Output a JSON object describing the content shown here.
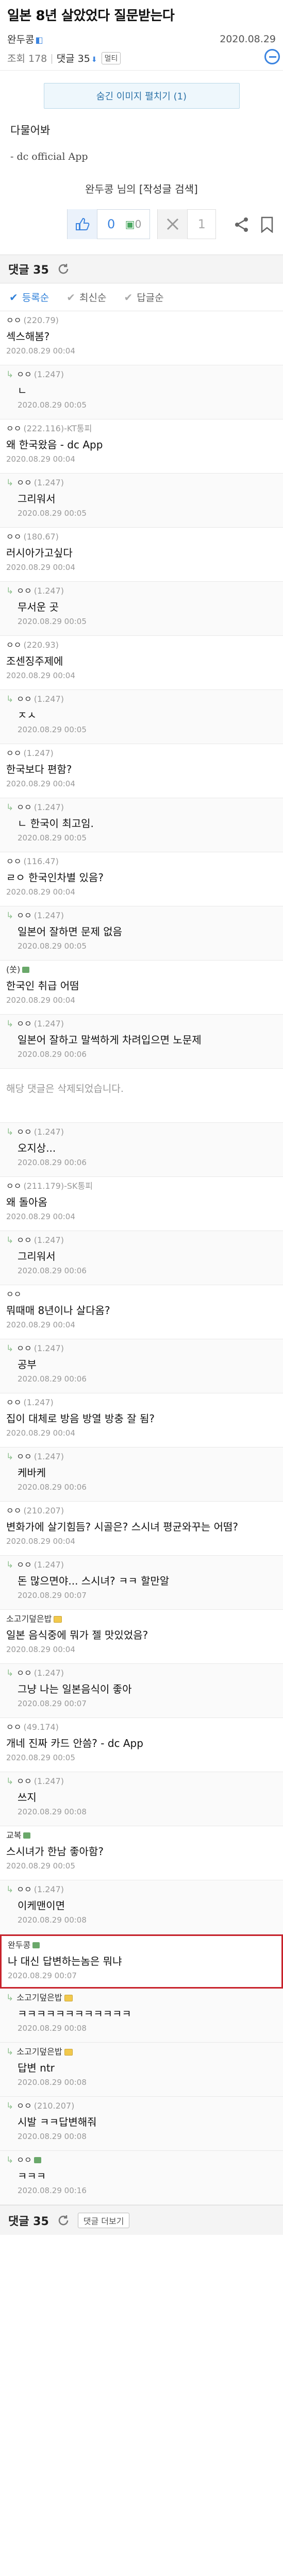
{
  "post": {
    "title": "일본 8년 살았었다 질문받는다",
    "author": "완두콩",
    "date": "2020.08.29",
    "views": "조회 178",
    "comment_count": "댓글 35",
    "chip": "멀티",
    "image_toggle": "숨긴 이미지 펼치기 (1)",
    "body_line": "다물어봐",
    "signature": "- dc official App",
    "search_name": "완두콩 님의",
    "search_link": "[작성글 검색]",
    "vote_up": "0",
    "fix_count": "0",
    "vote_down": "1"
  },
  "comments_header": {
    "label": "댓글 35"
  },
  "sort": {
    "options": [
      "등록순",
      "최신순",
      "답글순"
    ]
  },
  "comments": [
    {
      "reply": false,
      "nick": "ㅇㅇ",
      "ip": "(220.79)",
      "text": "섹스해봄?",
      "time": "2020.08.29 00:04"
    },
    {
      "reply": true,
      "nick": "ㅇㅇ",
      "ip": "(1.247)",
      "text": "ㄴ",
      "time": "2020.08.29 00:05"
    },
    {
      "reply": false,
      "nick": "ㅇㅇ",
      "ip": "(222.116)-KT통피",
      "text": "왜 한국왔음 - dc App",
      "time": "2020.08.29 00:04"
    },
    {
      "reply": true,
      "nick": "ㅇㅇ",
      "ip": "(1.247)",
      "text": "그리워서",
      "time": "2020.08.29 00:05"
    },
    {
      "reply": false,
      "nick": "ㅇㅇ",
      "ip": "(180.67)",
      "text": "러시아가고싶다",
      "time": "2020.08.29 00:04"
    },
    {
      "reply": true,
      "nick": "ㅇㅇ",
      "ip": "(1.247)",
      "text": "무서운 곳",
      "time": "2020.08.29 00:05"
    },
    {
      "reply": false,
      "nick": "ㅇㅇ",
      "ip": "(220.93)",
      "text": "조센징주제에",
      "time": "2020.08.29 00:04"
    },
    {
      "reply": true,
      "nick": "ㅇㅇ",
      "ip": "(1.247)",
      "text": "ㅈㅅ",
      "time": "2020.08.29 00:05"
    },
    {
      "reply": false,
      "nick": "ㅇㅇ",
      "ip": "(1.247)",
      "text": "한국보다 편함?",
      "time": "2020.08.29 00:04"
    },
    {
      "reply": true,
      "nick": "ㅇㅇ",
      "ip": "(1.247)",
      "text": "ㄴ 한국이 최고임.",
      "time": "2020.08.29 00:05"
    },
    {
      "reply": false,
      "nick": "ㅇㅇ",
      "ip": "(116.47)",
      "text": "ㄹㅇ 한국인차별 있음?",
      "time": "2020.08.29 00:04"
    },
    {
      "reply": true,
      "nick": "ㅇㅇ",
      "ip": "(1.247)",
      "text": "일본어 잘하면 문제 없음",
      "time": "2020.08.29 00:05"
    },
    {
      "reply": false,
      "nick": "(쏫)",
      "ip": "",
      "badge": "green",
      "text": "한국인 취급 어떰",
      "time": "2020.08.29 00:04"
    },
    {
      "reply": true,
      "nick": "ㅇㅇ",
      "ip": "(1.247)",
      "text": "일본어 잘하고 말썩하게 차려입으면 노문제",
      "time": "2020.08.29 00:06"
    },
    {
      "reply": false,
      "deleted": true,
      "text": "해당 댓글은 삭제되었습니다."
    },
    {
      "reply": true,
      "nick": "ㅇㅇ",
      "ip": "(1.247)",
      "text": "오지상...",
      "time": "2020.08.29 00:06"
    },
    {
      "reply": false,
      "nick": "ㅇㅇ",
      "ip": "(211.179)-SK통피",
      "text": "왜 돌아옴",
      "time": "2020.08.29 00:04"
    },
    {
      "reply": true,
      "nick": "ㅇㅇ",
      "ip": "(1.247)",
      "text": "그리워서",
      "time": "2020.08.29 00:06"
    },
    {
      "reply": false,
      "nick": "ㅇㅇ",
      "ip": "",
      "text": "뭐때매 8년이나 살다옴?",
      "time": "2020.08.29 00:04"
    },
    {
      "reply": true,
      "nick": "ㅇㅇ",
      "ip": "(1.247)",
      "text": "공부",
      "time": "2020.08.29 00:06"
    },
    {
      "reply": false,
      "nick": "ㅇㅇ",
      "ip": "(1.247)",
      "text": "집이 대체로 방음 방열 방충 잘 됨?",
      "time": "2020.08.29 00:04"
    },
    {
      "reply": true,
      "nick": "ㅇㅇ",
      "ip": "(1.247)",
      "text": "케바케",
      "time": "2020.08.29 00:06"
    },
    {
      "reply": false,
      "nick": "ㅇㅇ",
      "ip": "(210.207)",
      "text": "변화가에 살기힘듬? 시골은? 스시녀 평균와꾸는 어떰?",
      "time": "2020.08.29 00:04"
    },
    {
      "reply": true,
      "nick": "ㅇㅇ",
      "ip": "(1.247)",
      "text": "돈 많으면야... 스시녀? ㅋㅋ 할만알",
      "time": "2020.08.29 00:07"
    },
    {
      "reply": false,
      "nick": "소고기덮은밥",
      "ip": "",
      "badge": "yellow",
      "text": "일본 음식중에 뭐가 젤 맛있었음?",
      "time": "2020.08.29 00:04"
    },
    {
      "reply": true,
      "nick": "ㅇㅇ",
      "ip": "(1.247)",
      "text": "그냥 나는 일본음식이 좋아",
      "time": "2020.08.29 00:07"
    },
    {
      "reply": false,
      "nick": "ㅇㅇ",
      "ip": "(49.174)",
      "text": "개네 진짜 카드 안씀? - dc App",
      "time": "2020.08.29 00:05"
    },
    {
      "reply": true,
      "nick": "ㅇㅇ",
      "ip": "(1.247)",
      "text": "쓰지",
      "time": "2020.08.29 00:08"
    },
    {
      "reply": false,
      "nick": "교복",
      "ip": "",
      "badge": "green",
      "text": "스시녀가 한남 좋아함?",
      "time": "2020.08.29 00:05"
    },
    {
      "reply": true,
      "nick": "ㅇㅇ",
      "ip": "(1.247)",
      "text": "이케맨이면",
      "time": "2020.08.29 00:08"
    },
    {
      "reply": false,
      "nick": "완두콩",
      "ip": "",
      "badge": "green",
      "highlight": true,
      "text": "나 대신 답변하는놈은 뭐냐",
      "time": "2020.08.29 00:07"
    },
    {
      "reply": true,
      "nick": "소고기덮은밥",
      "ip": "",
      "badge": "yellow",
      "text": "ㅋㅋㅋㅋㅋㅋㅋㅋㅋㅋㅋㅋ",
      "time": "2020.08.29 00:08"
    },
    {
      "reply": true,
      "nick": "소고기덮은밥",
      "ip": "",
      "badge": "yellow",
      "text": "답변 ntr",
      "time": "2020.08.29 00:08"
    },
    {
      "reply": true,
      "nick": "ㅇㅇ",
      "ip": "(210.207)",
      "text": "시발 ㅋㅋ답변해줘",
      "time": "2020.08.29 00:08"
    },
    {
      "reply": true,
      "nick": "ㅇㅇ",
      "ip": "",
      "badge": "green",
      "text": "ㅋㅋㅋ",
      "time": "2020.08.29 00:16"
    }
  ],
  "footer": {
    "label": "댓글 35",
    "more": "댓글 더보기"
  },
  "colors": {
    "accent": "#3b84e0",
    "highlight_border": "#c8232c",
    "reply_arrow": "#8ec08e"
  }
}
